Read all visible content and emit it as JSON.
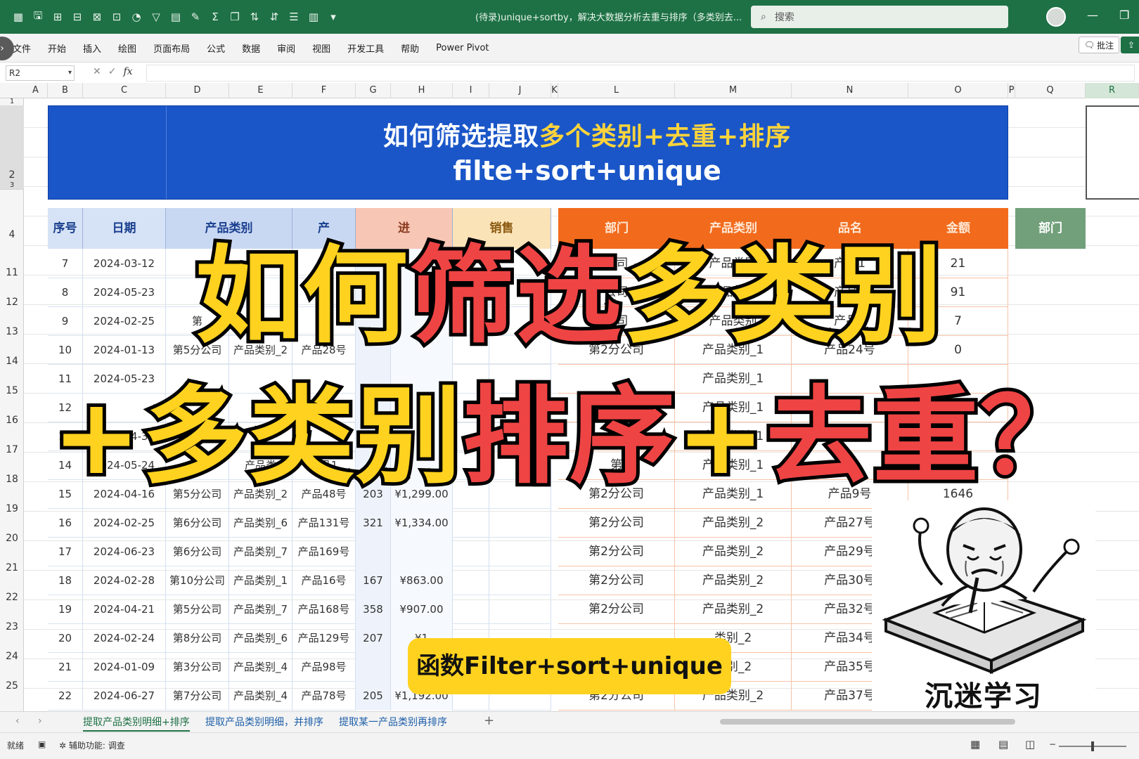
{
  "titlebar": {
    "doc_title": "(待录)unique+sortby，解决大数据分析去重与排序（多类别去...",
    "search_placeholder": "搜索",
    "qat_icons": [
      "excel-logo-icon",
      "save-icon",
      "insert-rows-icon",
      "delete-rows-icon",
      "merge-icon",
      "unmerge-icon",
      "shapes-icon",
      "filter-icon",
      "table-icon",
      "format-painter-icon",
      "sum-icon",
      "copy-format-icon",
      "sort-asc-icon",
      "sort-desc-icon",
      "align-icon",
      "freeze-icon"
    ]
  },
  "ribbon": {
    "tabs": [
      "文件",
      "开始",
      "插入",
      "绘图",
      "页面布局",
      "公式",
      "数据",
      "审阅",
      "视图",
      "开发工具",
      "帮助",
      "Power Pivot"
    ],
    "comment_label": "批注"
  },
  "formula_bar": {
    "name_box": "R2",
    "fx": "fx",
    "formula": ""
  },
  "columns": [
    "A",
    "B",
    "C",
    "D",
    "E",
    "F",
    "G",
    "H",
    "I",
    "J",
    "K",
    "L",
    "M",
    "N",
    "O",
    "P",
    "Q",
    "R"
  ],
  "row_numbers": [
    "1",
    "2",
    "3",
    "4",
    "11",
    "12",
    "13",
    "14",
    "15",
    "16",
    "17",
    "18",
    "19",
    "20",
    "21",
    "22",
    "23",
    "24",
    "25"
  ],
  "banner": {
    "line1_prefix": "如何筛选提取",
    "line1_highlight": "多个类别+去重+排序",
    "line2": "filte+sort+unique"
  },
  "left_table": {
    "headers": [
      "序号",
      "日期",
      "产品类别",
      "产",
      "进",
      "销售"
    ],
    "rows": [
      [
        "7",
        "2024-03-12",
        "",
        "",
        "",
        "",
        ""
      ],
      [
        "8",
        "2024-05-23",
        "",
        "",
        "",
        "",
        ""
      ],
      [
        "9",
        "2024-02-25",
        "第",
        "1",
        "号",
        "",
        ""
      ],
      [
        "10",
        "2024-01-13",
        "第5分公司",
        "产品类别_2",
        "产品28号",
        "",
        ""
      ],
      [
        "11",
        "2024-05-23",
        "",
        "",
        "",
        "",
        ""
      ],
      [
        "12",
        "",
        "",
        "",
        "",
        "",
        ""
      ],
      [
        "13",
        "2024-04-30",
        "",
        "",
        "",
        "",
        ""
      ],
      [
        "14",
        "2024-05-24",
        "公司",
        "产品类",
        "产品1",
        "18",
        ""
      ],
      [
        "15",
        "2024-04-16",
        "第5分公司",
        "产品类别_2",
        "产品48号",
        "203",
        "¥1,299.00"
      ],
      [
        "16",
        "2024-02-25",
        "第6分公司",
        "产品类别_6",
        "产品131号",
        "321",
        "¥1,334.00"
      ],
      [
        "17",
        "2024-06-23",
        "第6分公司",
        "产品类别_7",
        "产品169号",
        "",
        ""
      ],
      [
        "18",
        "2024-02-28",
        "第10分公司",
        "产品类别_1",
        "产品16号",
        "167",
        "¥863.00"
      ],
      [
        "19",
        "2024-04-21",
        "第5分公司",
        "产品类别_7",
        "产品168号",
        "358",
        "¥907.00"
      ],
      [
        "20",
        "2024-02-24",
        "第8分公司",
        "产品类别_6",
        "产品129号",
        "207",
        "¥1"
      ],
      [
        "21",
        "2024-01-09",
        "第3分公司",
        "产品类别_4",
        "产品98号",
        "",
        ""
      ],
      [
        "22",
        "2024-06-27",
        "第7分公司",
        "产品类别_4",
        "产品78号",
        "205",
        "¥1,192.00"
      ]
    ]
  },
  "right_table": {
    "headers": [
      "部门",
      "产品类别",
      "品名",
      "金额"
    ],
    "rows": [
      [
        "公司",
        "产品类别",
        "产品1",
        "21"
      ],
      [
        "公司",
        "产品类别",
        "产品1",
        "91"
      ],
      [
        "公司",
        "产品类别",
        "产品2",
        "7"
      ],
      [
        "第2分公司",
        "产品类别_1",
        "产品24号",
        "0"
      ],
      [
        "",
        "产品类别_1",
        "",
        ""
      ],
      [
        "第",
        "产品类别_1",
        "",
        ""
      ],
      [
        "",
        "产品类别_1",
        "",
        ""
      ],
      [
        "第",
        "产品类别_1",
        "",
        ""
      ],
      [
        "第2分公司",
        "产品类别_1",
        "产品9号",
        "1646"
      ],
      [
        "第2分公司",
        "产品类别_2",
        "产品27号",
        ""
      ],
      [
        "第2分公司",
        "产品类别_2",
        "产品29号",
        ""
      ],
      [
        "第2分公司",
        "产品类别_2",
        "产品30号",
        ""
      ],
      [
        "第2分公司",
        "产品类别_2",
        "产品32号",
        ""
      ],
      [
        "",
        "类别_2",
        "产品34号",
        ""
      ],
      [
        "",
        "类别_2",
        "产品35号",
        ""
      ],
      [
        "第2分公司",
        "产品类别_2",
        "产品37号",
        ""
      ]
    ],
    "dept_header": "部门"
  },
  "overlay": {
    "line1": [
      {
        "t": "如何",
        "c": "y"
      },
      {
        "t": "筛选",
        "c": "rd"
      },
      {
        "t": "多类别",
        "c": "y"
      }
    ],
    "line2": [
      {
        "t": "+多类别",
        "c": "y"
      },
      {
        "t": "排序",
        "c": "rd"
      },
      {
        "t": "+",
        "c": "y"
      },
      {
        "t": "去重？",
        "c": "rd"
      }
    ],
    "pill": "函数Filter+sort+unique",
    "meme_caption": "沉迷学习"
  },
  "sheet_tabs": [
    "提取产品类别明细+排序",
    "提取产品类别明细，并排序",
    "提取某一产品类别再排序"
  ],
  "status": {
    "ready": "就绪",
    "accessibility": "辅助功能: 调查"
  },
  "colors": {
    "excel_green": "#1e7145",
    "banner_blue": "#1a56c8",
    "orange": "#f26b1d",
    "yellow": "#ffd21f",
    "red": "#ef4444"
  }
}
